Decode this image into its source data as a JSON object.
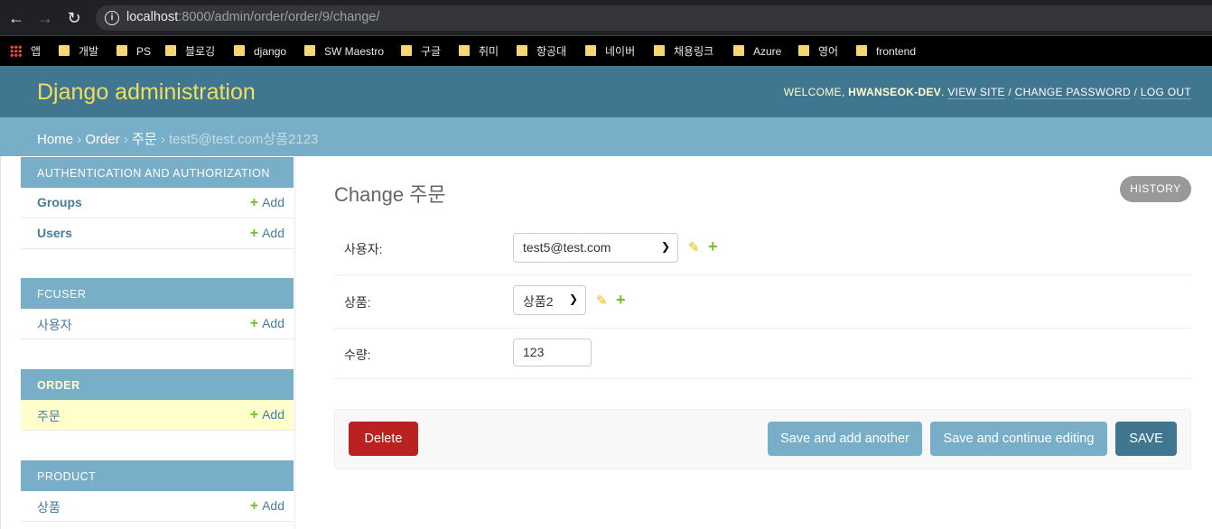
{
  "browser": {
    "url_host": "localhost",
    "url_path": ":8000/admin/order/order/9/change/",
    "bookmarks": [
      "앱",
      "개발",
      "PS",
      "블로깅",
      "django",
      "SW Maestro",
      "구글",
      "취미",
      "항공대",
      "네이버",
      "채용링크",
      "Azure",
      "영어",
      "frontend"
    ]
  },
  "header": {
    "branding": "Django administration",
    "welcome": "WELCOME,",
    "username": "HWANSEOK-DEV",
    "view_site": "VIEW SITE",
    "change_password": "CHANGE PASSWORD",
    "log_out": "LOG OUT",
    "sep": "/"
  },
  "breadcrumbs": {
    "home": "Home",
    "app": "Order",
    "model": "주문",
    "current": "test5@test.com상품2123",
    "sep": "›"
  },
  "sidebar": {
    "add_label": "Add",
    "modules": [
      {
        "caption": "AUTHENTICATION AND AUTHORIZATION",
        "models": [
          "Groups",
          "Users"
        ]
      },
      {
        "caption": "FCUSER",
        "models": [
          "사용자"
        ]
      },
      {
        "caption": "ORDER",
        "models": [
          "주문"
        ]
      },
      {
        "caption": "PRODUCT",
        "models": [
          "상품"
        ]
      }
    ]
  },
  "content": {
    "title": "Change 주문",
    "history": "HISTORY",
    "fields": {
      "user_label": "사용자:",
      "user_value": "test5@test.com",
      "product_label": "상품:",
      "product_value": "상품2",
      "quantity_label": "수량:",
      "quantity_value": "123"
    },
    "buttons": {
      "delete": "Delete",
      "save_add_another": "Save and add another",
      "save_continue": "Save and continue editing",
      "save": "SAVE"
    }
  },
  "colors": {
    "header_bg": "#417690",
    "breadcrumb_bg": "#79aec8",
    "branding": "#f5dd5d",
    "delete": "#ba2121",
    "add_green": "#70bf2b"
  }
}
